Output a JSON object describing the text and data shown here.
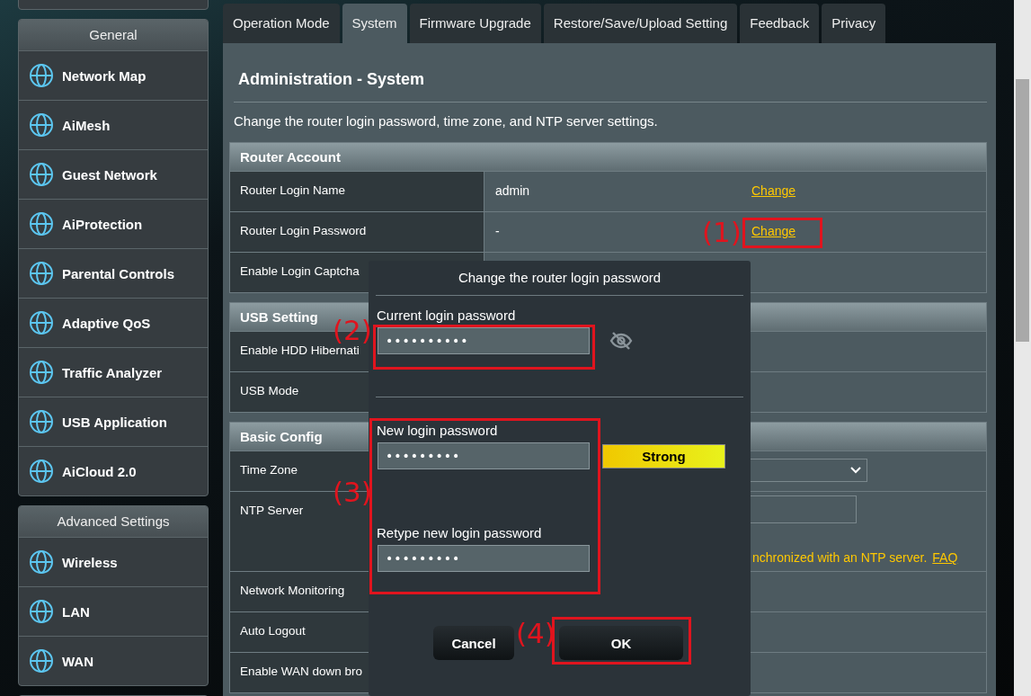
{
  "sidebar": {
    "sections": [
      {
        "title": "General",
        "items": [
          {
            "label": "Network Map"
          },
          {
            "label": "AiMesh"
          },
          {
            "label": "Guest Network"
          },
          {
            "label": "AiProtection"
          },
          {
            "label": "Parental Controls"
          },
          {
            "label": "Adaptive QoS"
          },
          {
            "label": "Traffic Analyzer"
          },
          {
            "label": "USB Application"
          },
          {
            "label": "AiCloud 2.0"
          }
        ]
      },
      {
        "title": "Advanced Settings",
        "items": [
          {
            "label": "Wireless"
          },
          {
            "label": "LAN"
          },
          {
            "label": "WAN"
          }
        ]
      }
    ]
  },
  "tabs": [
    {
      "label": "Operation Mode",
      "selected": false
    },
    {
      "label": "System",
      "selected": true
    },
    {
      "label": "Firmware Upgrade",
      "selected": false
    },
    {
      "label": "Restore/Save/Upload Setting",
      "selected": false
    },
    {
      "label": "Feedback",
      "selected": false
    },
    {
      "label": "Privacy",
      "selected": false
    }
  ],
  "page": {
    "title": "Administration - System",
    "description": "Change the router login password, time zone, and NTP server settings."
  },
  "sections": [
    {
      "title": "Router Account",
      "rows": [
        {
          "label": "Router Login Name",
          "value": "admin",
          "link": "Change"
        },
        {
          "label": "Router Login Password",
          "value": "-",
          "link": "Change"
        },
        {
          "label": "Enable Login Captcha"
        }
      ]
    },
    {
      "title": "USB Setting",
      "rows": [
        {
          "label": "Enable HDD Hibernati"
        },
        {
          "label": "USB Mode"
        }
      ]
    },
    {
      "title": "Basic Config",
      "rows": [
        {
          "label": "Time Zone",
          "kind": "select"
        },
        {
          "label": "NTP Server",
          "kind": "ntp",
          "note": "nchronized with an NTP server.",
          "link": "FAQ"
        },
        {
          "label": "Network Monitoring"
        },
        {
          "label": "Auto Logout"
        },
        {
          "label": "Enable WAN down bro"
        }
      ]
    }
  ],
  "dialog": {
    "title": "Change the router login password",
    "current": {
      "label": "Current login password",
      "value": "••••••••••"
    },
    "new": {
      "label": "New login password",
      "value": "•••••••••"
    },
    "strength": {
      "label": "Strong",
      "level": 1
    },
    "retype": {
      "label": "Retype new login password",
      "value": "•••••••••"
    },
    "buttons": [
      "Cancel",
      "OK"
    ]
  },
  "annotations": [
    "(1)",
    "(2)",
    "(3)",
    "(4)"
  ]
}
